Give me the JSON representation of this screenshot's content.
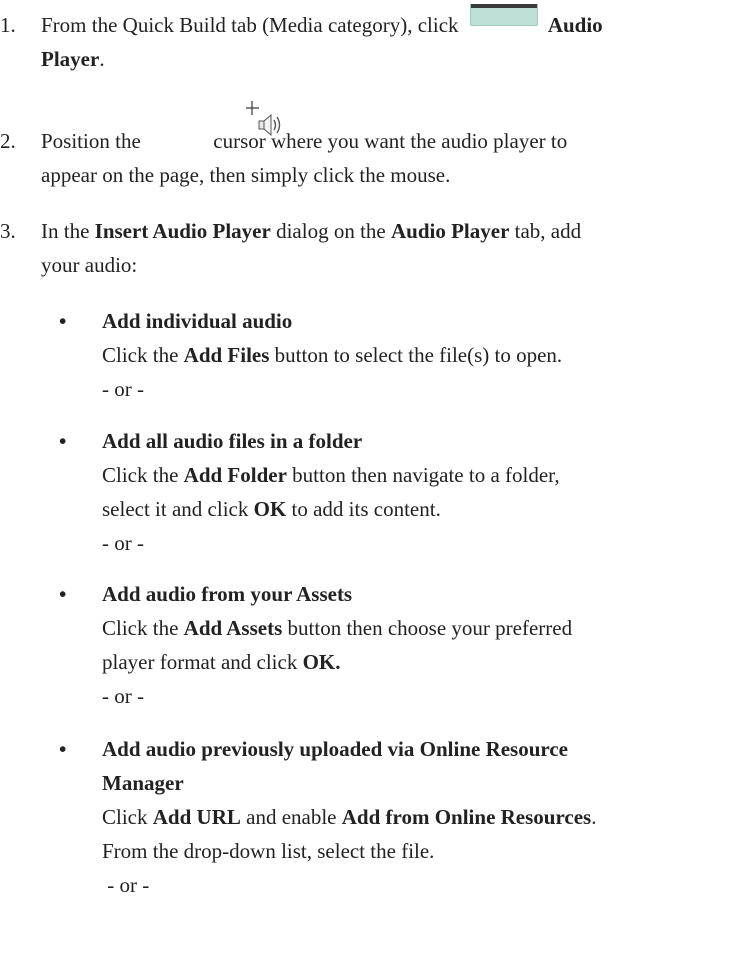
{
  "steps": [
    {
      "number": "1.",
      "text_before_icon": "From the Quick Build tab (Media category), click",
      "icon": "audio-player-icon",
      "bold_after_icon": "Audio",
      "line2_bold": "Player",
      "line2_tail": "."
    },
    {
      "number": "2.",
      "text_before_icon": "Position the",
      "icon": "audio-cursor-icon",
      "text_after_icon": "cursor where you want the audio player to",
      "line2": "appear on the page, then simply click the mouse."
    },
    {
      "number": "3.",
      "p1": "In the ",
      "b1": "Insert Audio Player",
      "p2": " dialog on the ",
      "b2": "Audio Player",
      "p3": " tab, add",
      "line2": "your audio:"
    }
  ],
  "options": [
    {
      "bullet": "•",
      "heading": "Add individual audio",
      "l1a": "Click the ",
      "l1b": "Add Files",
      "l1c": " button to select the file(s) to open.",
      "or": "- or -"
    },
    {
      "bullet": "•",
      "heading": "Add all audio files in a folder",
      "l1a": "Click the ",
      "l1b": "Add Folder",
      "l1c": " button then navigate to a folder,",
      "l2a": "select it and click ",
      "l2b": "OK",
      "l2c": " to add its content.",
      "or": "- or -"
    },
    {
      "bullet": "•",
      "heading": "Add audio from your Assets",
      "l1a": "Click the ",
      "l1b": "Add Assets",
      "l1c": " button then choose your preferred",
      "l2a": "player format and click ",
      "l2b": "OK.",
      "or": "- or -"
    },
    {
      "bullet": "•",
      "heading_l1": "Add audio previously uploaded via Online Resource",
      "heading_l2": "Manager",
      "l1a": "Click ",
      "l1b": "Add URL",
      "l1c": " and enable ",
      "l1d": "Add from Online Resources",
      "l1e": ".",
      "l2": "From the drop-down list, select the file.",
      "or": " - or -"
    }
  ],
  "colors": {
    "text": "#222222",
    "icon_fill": "#bfe0d6",
    "icon_top": "#3a3a3a"
  }
}
